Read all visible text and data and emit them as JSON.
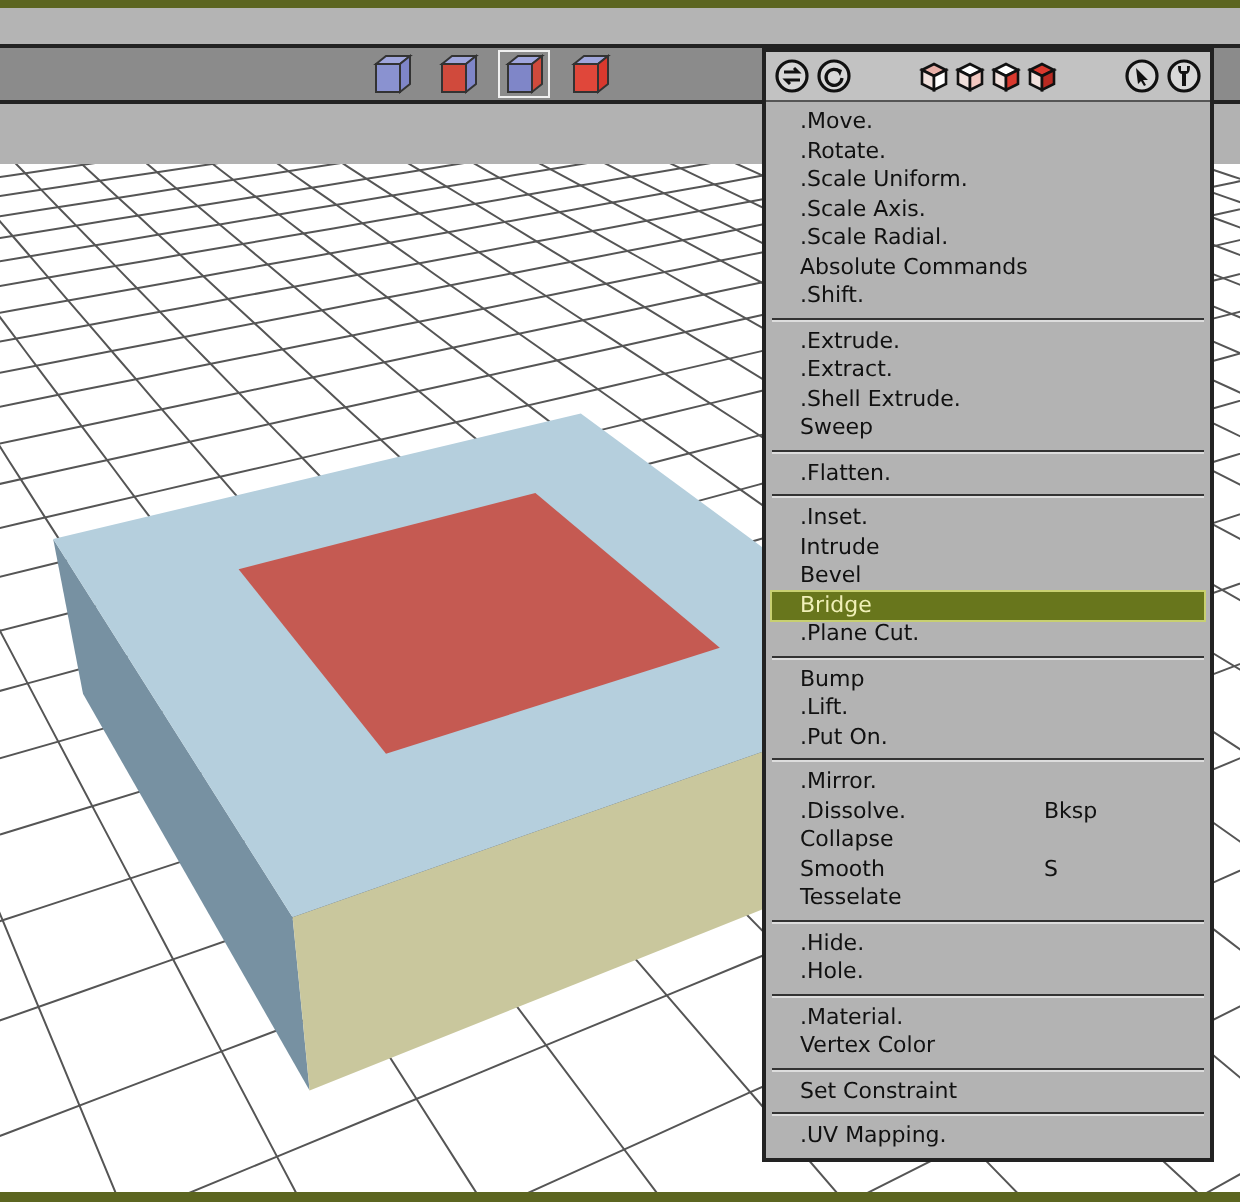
{
  "toolbar": {
    "selection_modes": [
      {
        "kind": "vertex",
        "selected": false
      },
      {
        "kind": "edge",
        "selected": false
      },
      {
        "kind": "face",
        "selected": true
      },
      {
        "kind": "body",
        "selected": false
      }
    ]
  },
  "menu": {
    "groups": [
      {
        "items": [
          {
            "label": ".Move.",
            "selected": false
          },
          {
            "label": ".Rotate.",
            "selected": false
          },
          {
            "label": ".Scale Uniform.",
            "selected": false
          },
          {
            "label": ".Scale Axis.",
            "selected": false
          },
          {
            "label": ".Scale Radial.",
            "selected": false
          },
          {
            "label": "Absolute Commands",
            "selected": false
          },
          {
            "label": ".Shift.",
            "selected": false
          }
        ]
      },
      {
        "items": [
          {
            "label": ".Extrude.",
            "selected": false
          },
          {
            "label": ".Extract.",
            "selected": false
          },
          {
            "label": ".Shell Extrude.",
            "selected": false
          },
          {
            "label": "Sweep",
            "selected": false
          }
        ]
      },
      {
        "items": [
          {
            "label": ".Flatten.",
            "selected": false
          }
        ]
      },
      {
        "items": [
          {
            "label": ".Inset.",
            "selected": false
          },
          {
            "label": "Intrude",
            "selected": false
          },
          {
            "label": "Bevel",
            "selected": false
          },
          {
            "label": "Bridge",
            "selected": true
          },
          {
            "label": ".Plane Cut.",
            "selected": false
          }
        ]
      },
      {
        "items": [
          {
            "label": "Bump",
            "selected": false
          },
          {
            "label": ".Lift.",
            "selected": false
          },
          {
            "label": ".Put On.",
            "selected": false
          }
        ]
      },
      {
        "items": [
          {
            "label": ".Mirror.",
            "selected": false
          },
          {
            "label": ".Dissolve.",
            "shortcut": "Bksp",
            "selected": false
          },
          {
            "label": "Collapse",
            "selected": false
          },
          {
            "label": "Smooth",
            "shortcut": "S",
            "selected": false
          },
          {
            "label": "Tesselate",
            "selected": false
          }
        ]
      },
      {
        "items": [
          {
            "label": ".Hide.",
            "selected": false
          },
          {
            "label": ".Hole.",
            "selected": false
          }
        ]
      },
      {
        "items": [
          {
            "label": ".Material.",
            "selected": false
          },
          {
            "label": "Vertex Color",
            "selected": false
          }
        ]
      },
      {
        "items": [
          {
            "label": "Set Constraint",
            "selected": false
          }
        ]
      },
      {
        "items": [
          {
            "label": ".UV Mapping.",
            "selected": false
          }
        ]
      }
    ]
  }
}
